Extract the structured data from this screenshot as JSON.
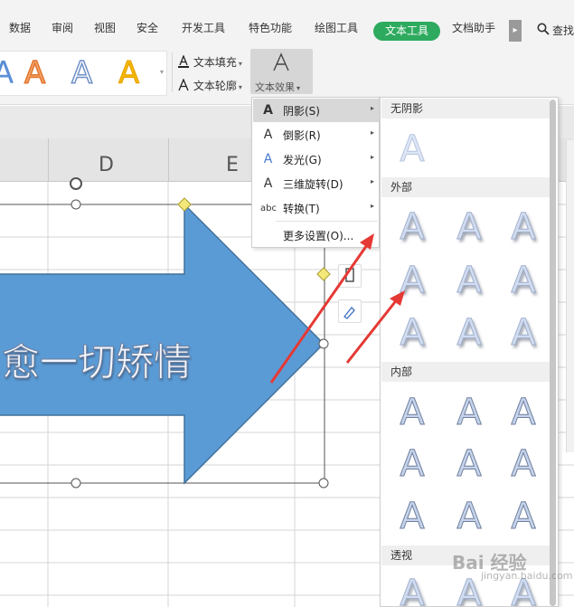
{
  "menubar": {
    "items": [
      "数据",
      "审阅",
      "视图",
      "安全",
      "开发工具",
      "特色功能",
      "绘图工具"
    ],
    "active": "文本工具",
    "after_active": "文档助手",
    "search_label": "查找"
  },
  "ribbon": {
    "text_fill_label": "文本填充",
    "text_outline_label": "文本轮廓",
    "text_effect_label": "文本效果",
    "style_glyph": "A"
  },
  "sheet": {
    "columns": [
      "D",
      "E"
    ],
    "shape_text": "愈一切矫情",
    "colors": {
      "arrow_fill": "#5b9bd5",
      "arrow_stroke": "#41719c",
      "annotation": "#e53935"
    }
  },
  "dropdown": {
    "items": [
      {
        "icon": "A",
        "label": "阴影(S)",
        "submenu": true,
        "highlighted": true
      },
      {
        "icon": "A",
        "label": "倒影(R)",
        "submenu": true,
        "highlighted": false
      },
      {
        "icon": "A",
        "label": "发光(G)",
        "submenu": true,
        "highlighted": false
      },
      {
        "icon": "A",
        "label": "三维旋转(D)",
        "submenu": true,
        "highlighted": false
      },
      {
        "icon": "abc",
        "label": "转换(T)",
        "submenu": true,
        "highlighted": false
      },
      {
        "icon": "",
        "label": "更多设置(O)...",
        "submenu": false,
        "highlighted": false
      }
    ]
  },
  "gallery": {
    "section_none": "无阴影",
    "section_outer": "外部",
    "section_inner": "内部",
    "section_perspective": "透视",
    "glyph": "A"
  },
  "watermark": {
    "text": "Bai 经验",
    "sub": "jingyan.baidu.com"
  }
}
